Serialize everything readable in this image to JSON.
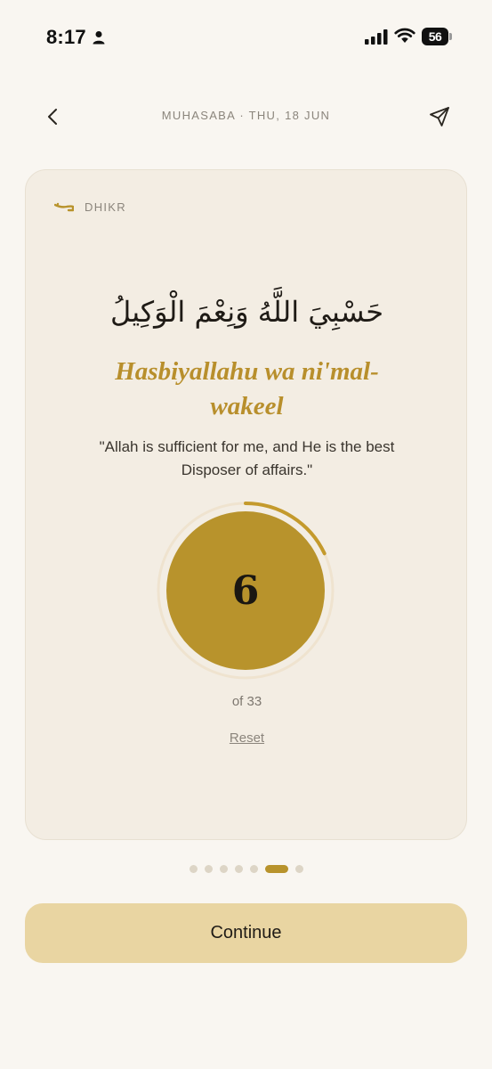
{
  "status_bar": {
    "time": "8:17",
    "battery_level": "56"
  },
  "header": {
    "title": "MUHASABA · THU, 18 JUN",
    "back_icon": "chevron-left-icon",
    "share_icon": "send-icon"
  },
  "card": {
    "section_label": "DHIKR",
    "arabic": "حَسْبِيَ اللَّهُ وَنِعْمَ الْوَكِيلُ",
    "transliteration": "Hasbiyallahu wa ni'mal-wakeel",
    "translation": "\"Allah is sufficient for me, and He is the best Disposer of affairs.\"",
    "counter": {
      "count": 6,
      "count_label": "6",
      "total_label": "of 33",
      "progress": 0.18
    },
    "reset_label": "Reset"
  },
  "pagination": {
    "total": 7,
    "active_index": 5
  },
  "continue_label": "Continue",
  "colors": {
    "accent": "#b8932c",
    "background": "#f9f6f1",
    "card": "#f3ede3",
    "continue_bg": "#e9d5a2"
  }
}
